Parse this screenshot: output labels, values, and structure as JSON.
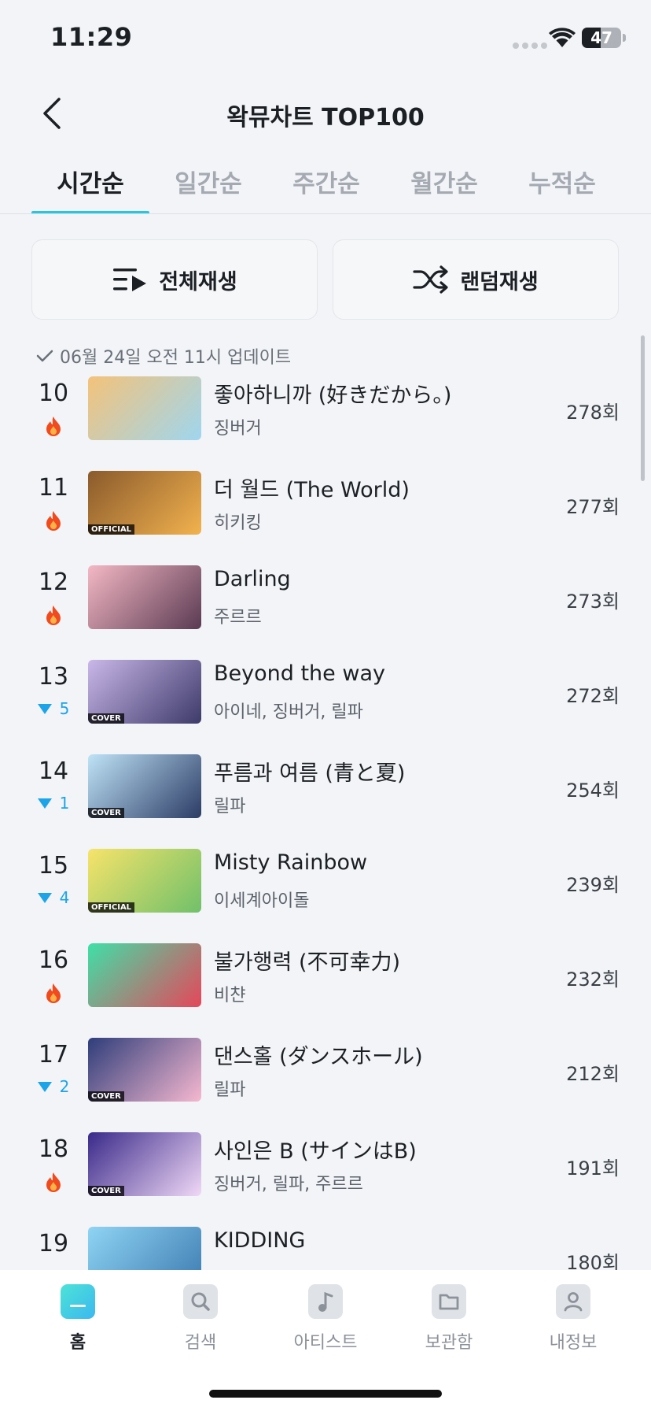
{
  "status": {
    "time": "11:29",
    "battery": "47",
    "battery_level": 0.47
  },
  "header": {
    "title": "왁뮤차트 TOP100"
  },
  "tabs": [
    {
      "label": "시간순",
      "active": true
    },
    {
      "label": "일간순",
      "active": false
    },
    {
      "label": "주간순",
      "active": false
    },
    {
      "label": "월간순",
      "active": false
    },
    {
      "label": "누적순",
      "active": false
    }
  ],
  "actions": {
    "play_all": "전체재생",
    "shuffle": "랜덤재생"
  },
  "update_text": "06월 24일 오전 11시 업데이트",
  "songs": [
    {
      "rank": "10",
      "change": "hot",
      "title": "좋아하니까 (好きだから。)",
      "artist": "징버거",
      "plays": "278회",
      "thumb_colors": [
        "#f4c27a",
        "#9fd6ef"
      ],
      "badge": ""
    },
    {
      "rank": "11",
      "change": "hot",
      "title": "더 월드 (The World)",
      "artist": "히키킹",
      "plays": "277회",
      "thumb_colors": [
        "#8a5a2c",
        "#f2b24e"
      ],
      "badge": "OFFICIAL"
    },
    {
      "rank": "12",
      "change": "hot",
      "title": "Darling",
      "artist": "주르르",
      "plays": "273회",
      "thumb_colors": [
        "#f4b8c4",
        "#5a3a52"
      ],
      "badge": ""
    },
    {
      "rank": "13",
      "change": "down",
      "change_value": "5",
      "title": "Beyond the way",
      "artist": "아이네, 징버거, 릴파",
      "plays": "272회",
      "thumb_colors": [
        "#c9b7e8",
        "#3d3a6a"
      ],
      "badge": "COVER"
    },
    {
      "rank": "14",
      "change": "down",
      "change_value": "1",
      "title": "푸름과 여름 (青と夏)",
      "artist": "릴파",
      "plays": "254회",
      "thumb_colors": [
        "#bfe3f7",
        "#2c3c66"
      ],
      "badge": "COVER"
    },
    {
      "rank": "15",
      "change": "down",
      "change_value": "4",
      "title": "Misty Rainbow",
      "artist": "이세계아이돌",
      "plays": "239회",
      "thumb_colors": [
        "#f7e36a",
        "#70c06a"
      ],
      "badge": "OFFICIAL"
    },
    {
      "rank": "16",
      "change": "hot",
      "title": "불가행력 (不可幸力)",
      "artist": "비챤",
      "plays": "232회",
      "thumb_colors": [
        "#3ee0a8",
        "#e5475a"
      ],
      "badge": ""
    },
    {
      "rank": "17",
      "change": "down",
      "change_value": "2",
      "title": "댄스홀 (ダンスホール)",
      "artist": "릴파",
      "plays": "212회",
      "thumb_colors": [
        "#2e3d7a",
        "#f6b8d0"
      ],
      "badge": "COVER"
    },
    {
      "rank": "18",
      "change": "hot",
      "title": "사인은 B (サインはB)",
      "artist": "징버거, 릴파, 주르르",
      "plays": "191회",
      "thumb_colors": [
        "#3a2a8a",
        "#f0d8f6"
      ],
      "badge": "COVER"
    },
    {
      "rank": "19",
      "change": "none",
      "title": "KIDDING",
      "artist": "",
      "plays": "180회",
      "thumb_colors": [
        "#8fd4f4",
        "#3c7ab0"
      ],
      "badge": ""
    }
  ],
  "bottom_nav": [
    {
      "label": "홈",
      "icon": "home-icon",
      "active": true
    },
    {
      "label": "검색",
      "icon": "search-icon",
      "active": false
    },
    {
      "label": "아티스트",
      "icon": "music-note-icon",
      "active": false
    },
    {
      "label": "보관함",
      "icon": "folder-icon",
      "active": false
    },
    {
      "label": "내정보",
      "icon": "person-icon",
      "active": false
    }
  ],
  "colors": {
    "accent": "#26c6e0",
    "down": "#1ca4e8",
    "hot": "#f04a1e"
  }
}
